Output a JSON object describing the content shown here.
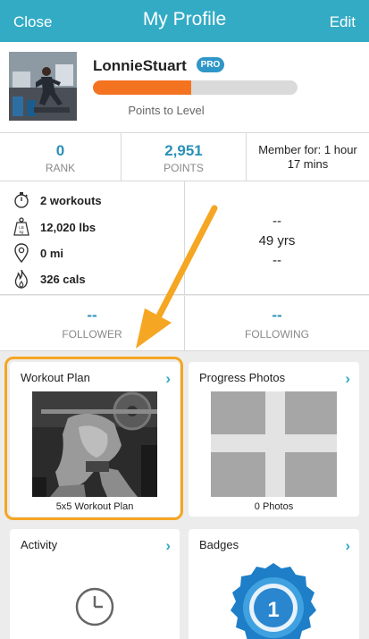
{
  "header": {
    "close_label": "Close",
    "title": "My Profile",
    "edit_label": "Edit"
  },
  "profile": {
    "username": "LonnieStuart",
    "badge": "PRO",
    "level_progress": 0.48,
    "level_label": "Points to Level"
  },
  "stats": {
    "rank": {
      "value": "0",
      "label": "RANK"
    },
    "points": {
      "value": "2,951",
      "label": "POINTS"
    },
    "member": {
      "line1": "Member for: 1 hour",
      "line2": "17 mins"
    }
  },
  "details": {
    "workouts": "2 workouts",
    "weight": "12,020 lbs",
    "distance": "0 mi",
    "calories": "326 cals",
    "right_line1": "--",
    "right_line2": "49 yrs",
    "right_line3": "--"
  },
  "follow": {
    "follower": {
      "value": "--",
      "label": "FOLLOWER"
    },
    "following": {
      "value": "--",
      "label": "FOLLOWING"
    }
  },
  "cards": {
    "workout_plan": {
      "title": "Workout Plan",
      "caption": "5x5 Workout Plan"
    },
    "progress_photos": {
      "title": "Progress Photos",
      "caption": "0 Photos"
    },
    "activity": {
      "title": "Activity"
    },
    "badges": {
      "title": "Badges",
      "badge_number": "1"
    }
  },
  "colors": {
    "header": "#33abc5",
    "accent": "#2a90b8",
    "progress": "#f37321",
    "highlight": "#f5a623"
  }
}
